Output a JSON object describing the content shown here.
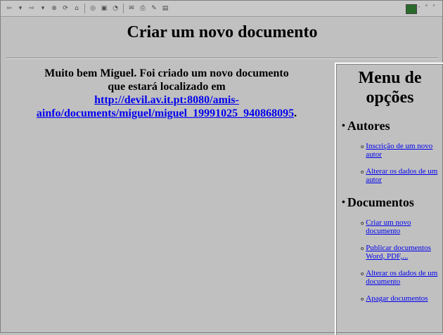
{
  "toolbar": {
    "icons": [
      "back-icon",
      "forward-icon",
      "stop-icon",
      "refresh-icon",
      "home-icon",
      "search-icon",
      "favorites-icon",
      "history-icon",
      "mail-icon",
      "print-icon",
      "edit-icon",
      "discuss-icon"
    ],
    "right_text": "- ᵃ ˣ"
  },
  "page": {
    "title": "Criar um novo documento"
  },
  "main": {
    "message_line1": "Muito bem Miguel. Foi criado um novo documento",
    "message_line2": "que estará localizado em",
    "link_text": "http://devil.av.it.pt:8080/amis-ainfo/documents/miguel/miguel_19991025_940868095",
    "link_suffix": "."
  },
  "menu": {
    "title": "Menu de opções",
    "sections": [
      {
        "label": "Autores",
        "items": [
          {
            "label": "Inscrição de um novo autor"
          },
          {
            "label": "Alterar os dados de um autor"
          }
        ]
      },
      {
        "label": "Documentos",
        "items": [
          {
            "label": "Criar um novo documento"
          },
          {
            "label": "Publicar documentos Word, PDF,..."
          },
          {
            "label": "Alterar os dados de um documento"
          },
          {
            "label": "Apagar documentos"
          }
        ]
      }
    ]
  }
}
